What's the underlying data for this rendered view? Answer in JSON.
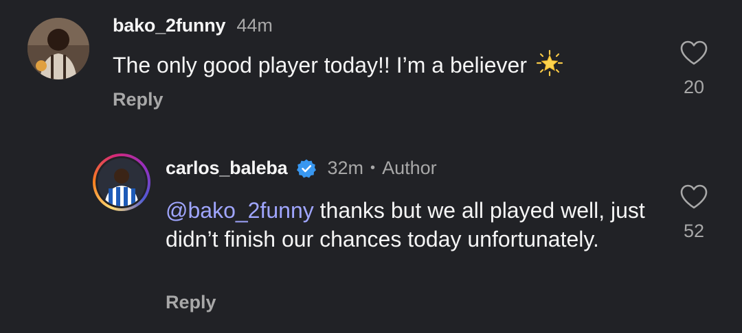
{
  "comments": [
    {
      "username": "bako_2funny",
      "timestamp": "44m",
      "text": "The only good player today!! I’m a believer",
      "emoji": "glowing-star",
      "reply_label": "Reply",
      "likes": "20",
      "avatar_icon": "user-avatar"
    },
    {
      "username": "carlos_baleba",
      "verified": true,
      "timestamp": "32m",
      "separator": "•",
      "role": "Author",
      "mention": "@bako_2funny",
      "text": " thanks but we all played well, just didn’t finish our chances today unfortunately.",
      "reply_label": "Reply",
      "likes": "52",
      "avatar_icon": "user-avatar-story-ring"
    }
  ],
  "colors": {
    "background": "#212226",
    "text_primary": "#f5f5f5",
    "text_secondary": "#a8a8a8",
    "mention": "#a0a6ff",
    "verified_blue": "#3897f0"
  }
}
